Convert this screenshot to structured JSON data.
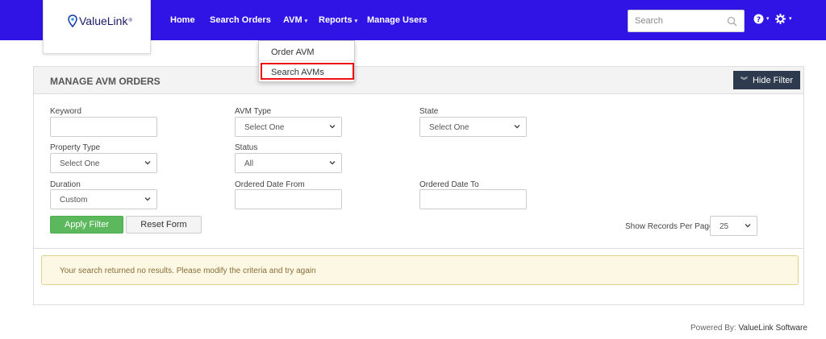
{
  "brand": {
    "name": "ValueLink",
    "mark": "®"
  },
  "nav": {
    "home": "Home",
    "search_orders": "Search Orders",
    "avm": "AVM",
    "reports": "Reports",
    "manage_users": "Manage Users"
  },
  "search": {
    "placeholder": "Search"
  },
  "avm_menu": {
    "order_avm": "Order AVM",
    "search_avms": "Search AVMs"
  },
  "panel": {
    "title": "MANAGE AVM ORDERS",
    "hide_filter": "Hide Filter"
  },
  "filters": {
    "keyword": {
      "label": "Keyword",
      "value": ""
    },
    "avm_type": {
      "label": "AVM Type",
      "value": "Select One"
    },
    "state": {
      "label": "State",
      "value": "Select One"
    },
    "property_type": {
      "label": "Property Type",
      "value": "Select One"
    },
    "status": {
      "label": "Status",
      "value": "All"
    },
    "duration": {
      "label": "Duration",
      "value": "Custom"
    },
    "ordered_from": {
      "label": "Ordered Date From",
      "value": ""
    },
    "ordered_to": {
      "label": "Ordered Date To",
      "value": ""
    }
  },
  "buttons": {
    "apply": "Apply Filter",
    "reset": "Reset Form"
  },
  "records": {
    "label": "Show Records Per Page",
    "value": "25"
  },
  "alert": "Your search returned no results. Please modify the criteria and try again",
  "footer": {
    "prefix": "Powered By:",
    "company": "ValueLink Software"
  },
  "colors": {
    "nav": "#3014e6",
    "apply": "#5cb85c",
    "alert_bg": "#fcf8e3",
    "highlight": "#ee1111",
    "hide_btn": "#2e3a4e"
  }
}
